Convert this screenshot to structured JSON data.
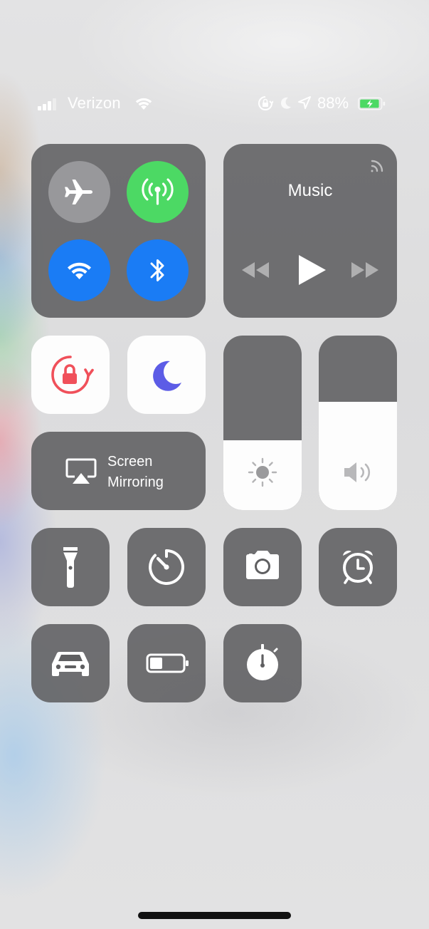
{
  "status_bar": {
    "carrier": "Verizon",
    "battery_percent": "88%",
    "signal_bars": 3,
    "signal_bars_max": 4,
    "battery_level": 0.88,
    "battery_color": "#4cd964",
    "icons": [
      "cellular-signal-icon",
      "wifi-icon",
      "orientation-lock-icon",
      "do-not-disturb-moon-icon",
      "location-arrow-icon",
      "battery-charging-icon"
    ]
  },
  "connectivity": {
    "airplane_mode": {
      "icon": "airplane-icon",
      "on": false,
      "color": "#8e8e90"
    },
    "cellular_data": {
      "icon": "cellular-antenna-icon",
      "on": true,
      "color": "#4cd964"
    },
    "wifi": {
      "icon": "wifi-icon",
      "on": true,
      "color": "#1a7cf5"
    },
    "bluetooth": {
      "icon": "bluetooth-icon",
      "on": true,
      "color": "#1a7cf5"
    }
  },
  "music": {
    "title": "Music",
    "controls": [
      "rewind-icon",
      "play-icon",
      "fast-forward-icon"
    ],
    "airplay_icon": "airplay-audio-icon"
  },
  "toggles": {
    "orientation_lock": {
      "icon": "orientation-lock-icon",
      "on": true,
      "color": "#f0505a"
    },
    "do_not_disturb": {
      "icon": "moon-icon",
      "on": true,
      "color": "#5c5ce6"
    }
  },
  "screen_mirroring": {
    "line1": "Screen",
    "line2": "Mirroring",
    "icon": "screen-mirroring-icon"
  },
  "brightness": {
    "level": 0.4,
    "icon": "sun-icon"
  },
  "volume": {
    "level": 0.62,
    "icon": "speaker-icon"
  },
  "shortcuts": [
    {
      "name": "flashlight",
      "icon": "flashlight-icon"
    },
    {
      "name": "timer",
      "icon": "timer-icon"
    },
    {
      "name": "camera",
      "icon": "camera-icon"
    },
    {
      "name": "alarm",
      "icon": "alarm-clock-icon"
    },
    {
      "name": "do-not-disturb-while-driving",
      "icon": "car-icon"
    },
    {
      "name": "low-power-mode",
      "icon": "battery-icon"
    },
    {
      "name": "stopwatch",
      "icon": "stopwatch-icon"
    }
  ],
  "colors": {
    "tile_dark": "#5f5f61",
    "tile_white": "#fdfdfd",
    "accent_blue": "#1a7cf5",
    "accent_green": "#4cd964"
  }
}
